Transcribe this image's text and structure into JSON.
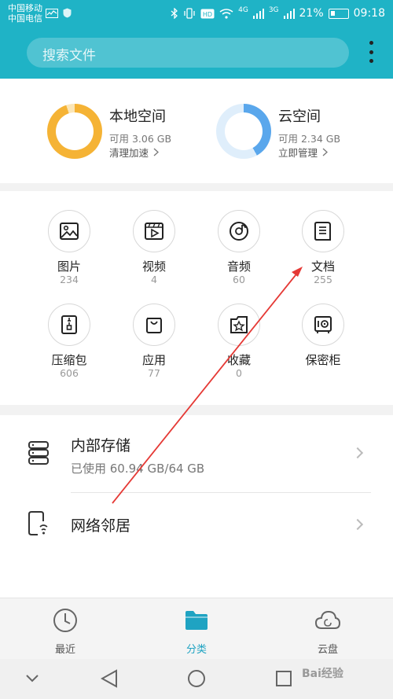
{
  "status_bar": {
    "carrier_1": "中国移动",
    "carrier_2": "中国电信",
    "network_1": "4G",
    "network_2": "3G",
    "battery": "21%",
    "time": "09:18",
    "icons": [
      "activity-icon",
      "shield-icon",
      "bluetooth-icon",
      "vibrate-icon",
      "hd-icon",
      "wifi-icon",
      "signal-icon",
      "battery-icon"
    ]
  },
  "search": {
    "placeholder": "搜索文件"
  },
  "colors": {
    "header": "#1fb3c6",
    "accent": "#1fa3c2",
    "local_ring": "#f5b335",
    "cloud_ring": "#5aa7ec",
    "annotation_arrow": "#e53935"
  },
  "storage": {
    "local": {
      "title": "本地空间",
      "available": "可用 3.06 GB",
      "action": "清理加速",
      "used_fraction": 0.95
    },
    "cloud": {
      "title": "云空间",
      "available": "可用 2.34 GB",
      "action": "立即管理",
      "used_fraction": 0.42
    }
  },
  "categories": [
    {
      "label": "图片",
      "count": "234",
      "icon": "image-icon"
    },
    {
      "label": "视频",
      "count": "4",
      "icon": "video-icon"
    },
    {
      "label": "音频",
      "count": "60",
      "icon": "audio-icon"
    },
    {
      "label": "文档",
      "count": "255",
      "icon": "document-icon"
    },
    {
      "label": "压缩包",
      "count": "606",
      "icon": "archive-icon"
    },
    {
      "label": "应用",
      "count": "77",
      "icon": "app-bag-icon"
    },
    {
      "label": "收藏",
      "count": "0",
      "icon": "favorite-star-icon"
    },
    {
      "label": "保密柜",
      "count": "",
      "icon": "safe-icon"
    }
  ],
  "locations": {
    "internal": {
      "title": "内部存储",
      "usage": "已使用 60.94 GB/64 GB",
      "icon": "storage-drive-icon"
    },
    "network": {
      "title": "网络邻居",
      "icon": "network-phone-icon"
    }
  },
  "bottom_nav": {
    "recent": {
      "label": "最近",
      "icon": "clock-icon"
    },
    "category": {
      "label": "分类",
      "icon": "folder-icon",
      "active": true
    },
    "cloud": {
      "label": "云盘",
      "icon": "cloud-icon"
    }
  },
  "system_nav": [
    "chevron-down-icon",
    "back-triangle-icon",
    "home-circle-icon",
    "recents-square-icon"
  ],
  "watermark": "Bai经验"
}
